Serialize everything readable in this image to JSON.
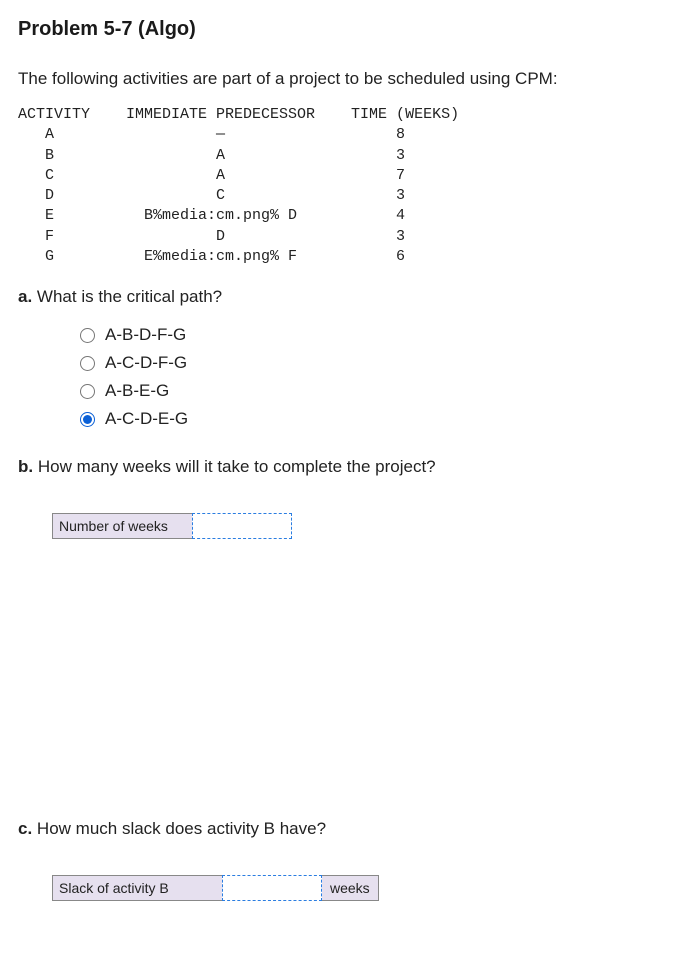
{
  "title": "Problem 5-7 (Algo)",
  "intro": "The following activities are part of a project to be scheduled using CPM:",
  "table": {
    "header": {
      "c1": "ACTIVITY",
      "c2": "IMMEDIATE PREDECESSOR",
      "c3": "TIME (WEEKS)"
    },
    "rows": [
      {
        "activity": "A",
        "pred": "—",
        "time": "8"
      },
      {
        "activity": "B",
        "pred": "A",
        "time": "3"
      },
      {
        "activity": "C",
        "pred": "A",
        "time": "7"
      },
      {
        "activity": "D",
        "pred": "C",
        "time": "3"
      },
      {
        "activity": "E",
        "pred": "B%media:cm.png% D",
        "time": "4"
      },
      {
        "activity": "F",
        "pred": "D",
        "time": "3"
      },
      {
        "activity": "G",
        "pred": "E%media:cm.png% F",
        "time": "6"
      }
    ]
  },
  "qa": {
    "letter": "a.",
    "text": "What is the critical path?",
    "options": [
      {
        "label": "A-B-D-F-G",
        "selected": false
      },
      {
        "label": "A-C-D-F-G",
        "selected": false
      },
      {
        "label": "A-B-E-G",
        "selected": false
      },
      {
        "label": "A-C-D-E-G",
        "selected": true
      }
    ]
  },
  "qb": {
    "letter": "b.",
    "text": "How many weeks will it take to complete the project?",
    "field_label": "Number of weeks"
  },
  "qc": {
    "letter": "c.",
    "text": "How much slack does activity B have?",
    "field_label": "Slack of activity B",
    "unit": "weeks"
  }
}
